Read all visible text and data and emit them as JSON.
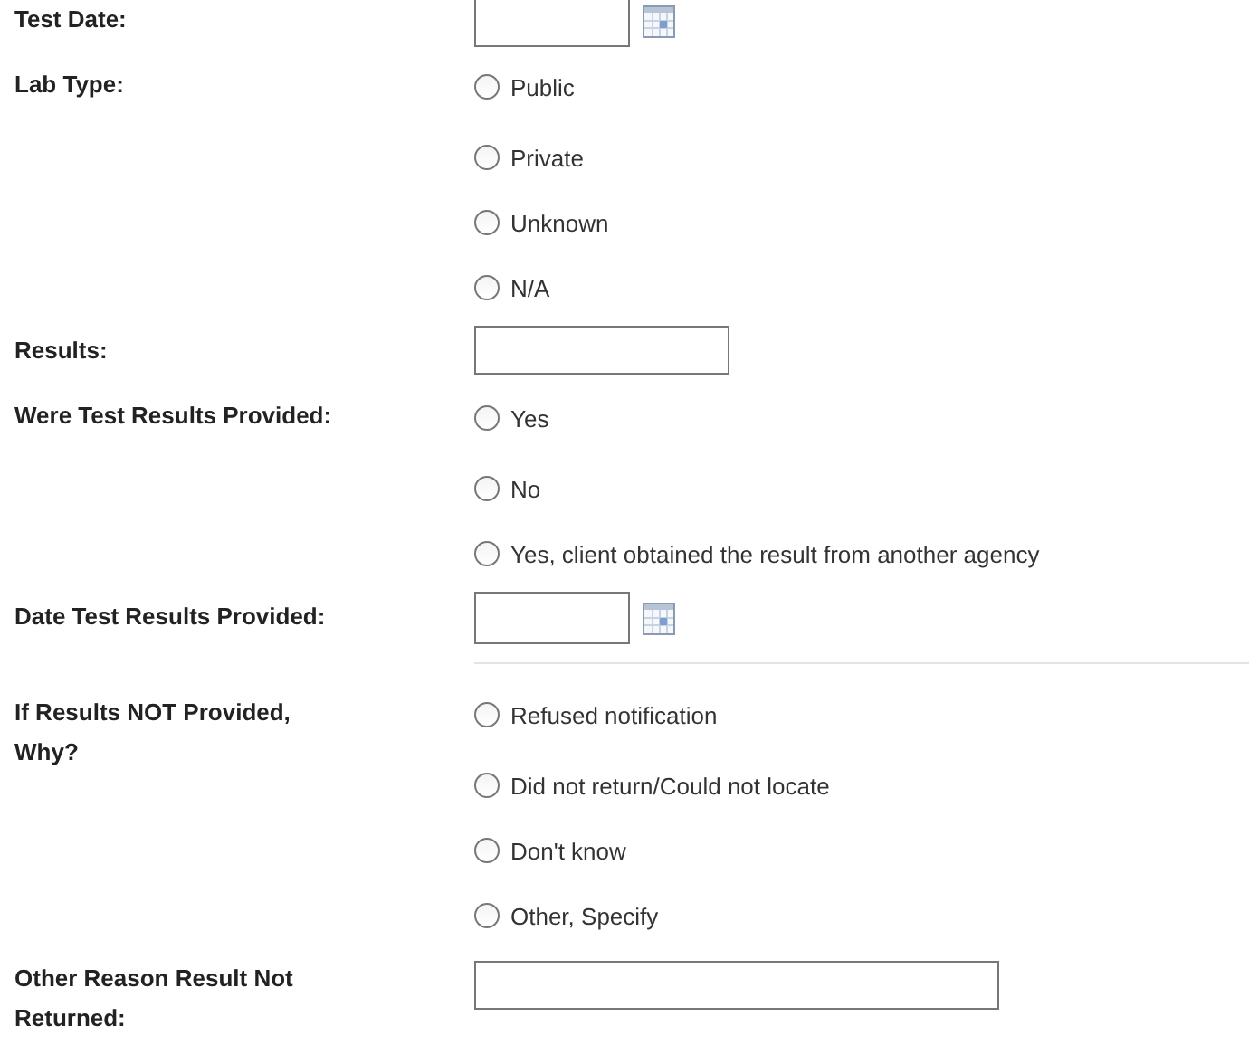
{
  "fields": [
    {
      "kind": "date",
      "label": "Test Date:"
    },
    {
      "kind": "radio",
      "label": "Lab Type:",
      "options": [
        {
          "label": "Public",
          "selected": false
        },
        {
          "label": "Private",
          "selected": false
        },
        {
          "label": "Unknown",
          "selected": false
        },
        {
          "label": "N/A",
          "selected": false
        }
      ]
    },
    {
      "kind": "text",
      "label": "Results:"
    },
    {
      "kind": "radio",
      "label": "Were Test Results Provided:",
      "options": [
        {
          "label": "Yes",
          "selected": false
        },
        {
          "label": "No",
          "selected": false
        },
        {
          "label": "Yes, client obtained the result from another agency",
          "selected": false
        }
      ]
    },
    {
      "kind": "date",
      "label": "Date Test Results Provided:"
    },
    {
      "kind": "divider"
    },
    {
      "kind": "radio",
      "label": "If Results NOT Provided, Why?",
      "options": [
        {
          "label": "Refused notification",
          "selected": false
        },
        {
          "label": "Did not return/Could not locate",
          "selected": false
        },
        {
          "label": "Don't know",
          "selected": false
        },
        {
          "label": "Other, Specify",
          "selected": false
        }
      ]
    },
    {
      "kind": "longtext",
      "label": "Other Reason Result Not Returned:"
    }
  ]
}
